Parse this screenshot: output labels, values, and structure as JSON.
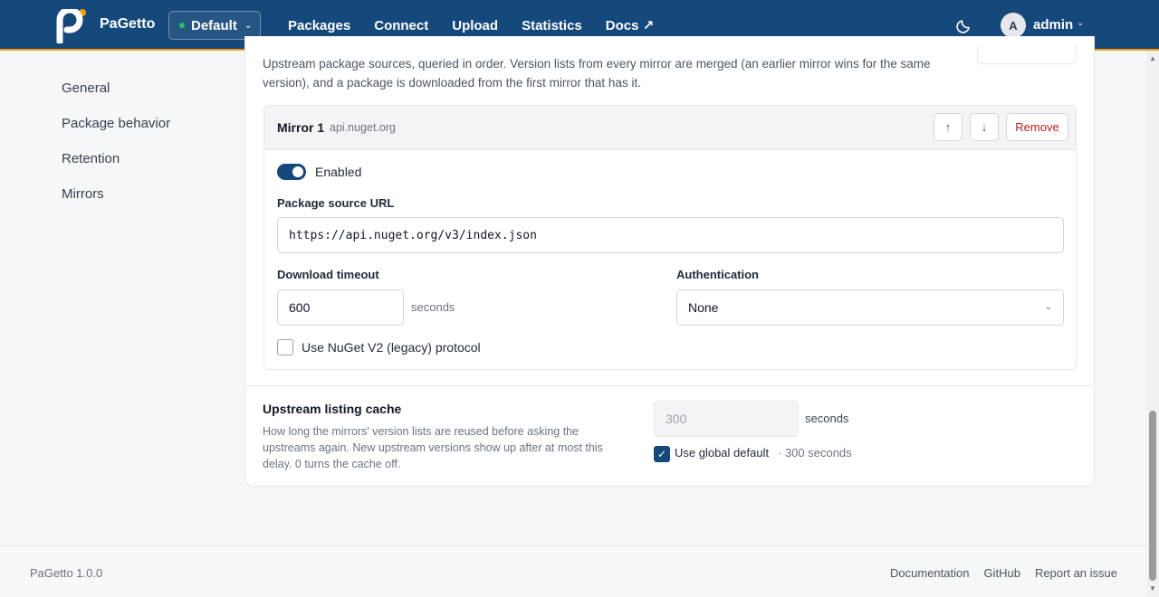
{
  "header": {
    "brand": "PaGetto",
    "tenant": "Default",
    "nav": [
      "Packages",
      "Connect",
      "Upload",
      "Statistics",
      "Docs ↗"
    ],
    "user_initial": "A",
    "user_name": "admin"
  },
  "sidebar": {
    "items": [
      "General",
      "Package behavior",
      "Retention",
      "Mirrors"
    ]
  },
  "mirrors_section": {
    "intro": "Upstream package sources, queried in order. Version lists from every mirror are merged (an earlier mirror wins for the same version), and a package is downloaded from the first mirror that has it.",
    "mirror": {
      "title": "Mirror 1",
      "host": "api.nuget.org",
      "move_up_label": "↑",
      "move_down_label": "↓",
      "remove_label": "Remove",
      "enabled_label": "Enabled",
      "url_label": "Package source URL",
      "url_value": "https://api.nuget.org/v3/index.json",
      "timeout_label": "Download timeout",
      "timeout_value": "600",
      "timeout_unit": "seconds",
      "auth_label": "Authentication",
      "auth_value": "None",
      "legacy_label": "Use NuGet V2 (legacy) protocol"
    }
  },
  "cache": {
    "title": "Upstream listing cache",
    "description": "How long the mirrors' version lists are reused before asking the upstreams again. New upstream versions show up after at most this delay. 0 turns the cache off.",
    "value": "300",
    "unit": "seconds",
    "global_default_label": "Use global default",
    "global_default_note": "· 300 seconds"
  },
  "footer": {
    "version": "PaGetto 1.0.0",
    "links": [
      "Documentation",
      "GitHub",
      "Report an issue"
    ]
  },
  "colors": {
    "primary": "#15487b",
    "accent": "#f59e0b",
    "danger": "#b91c1c"
  }
}
